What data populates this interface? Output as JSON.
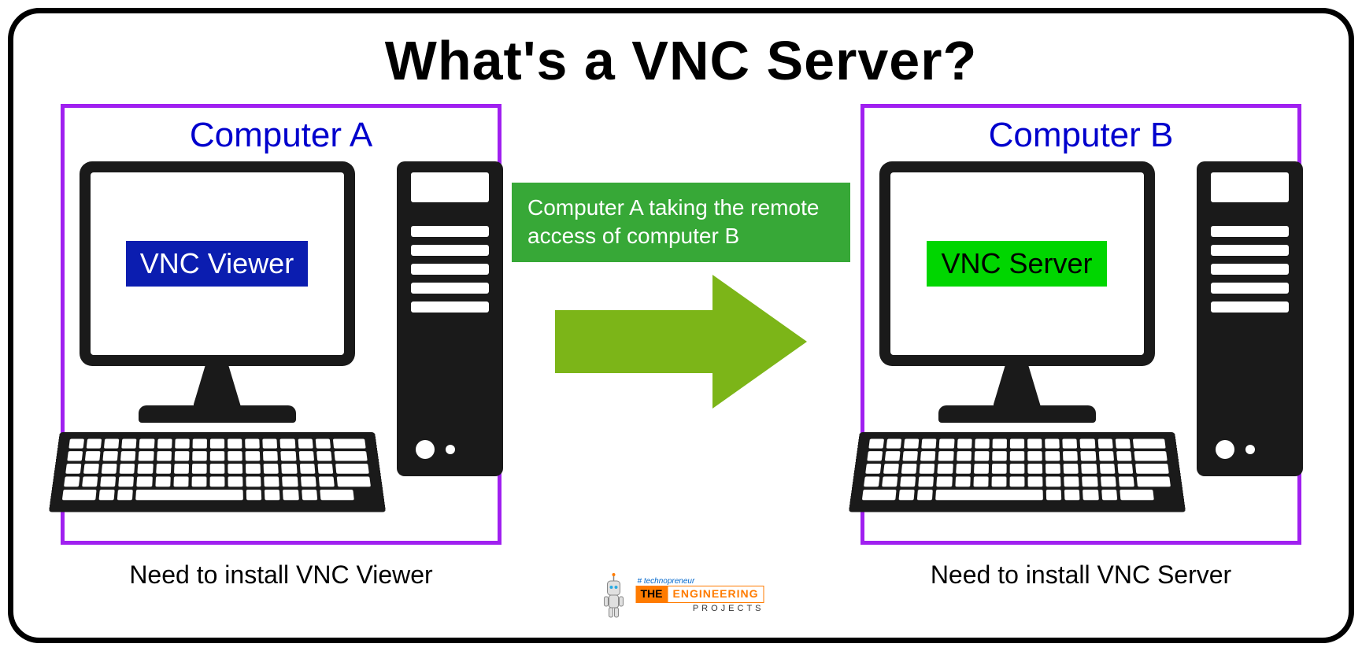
{
  "title": "What's a VNC Server?",
  "left": {
    "label": "Computer A",
    "badge": "VNC Viewer",
    "caption": "Need to install VNC Viewer"
  },
  "right": {
    "label": "Computer B",
    "badge": "VNC Server",
    "caption": "Need to install VNC Server"
  },
  "arrow_text": "Computer A taking the remote access of computer B",
  "logo": {
    "tag": "# technopreneur",
    "the": "THE",
    "eng": "ENGINEERING",
    "proj": "PROJECTS"
  }
}
